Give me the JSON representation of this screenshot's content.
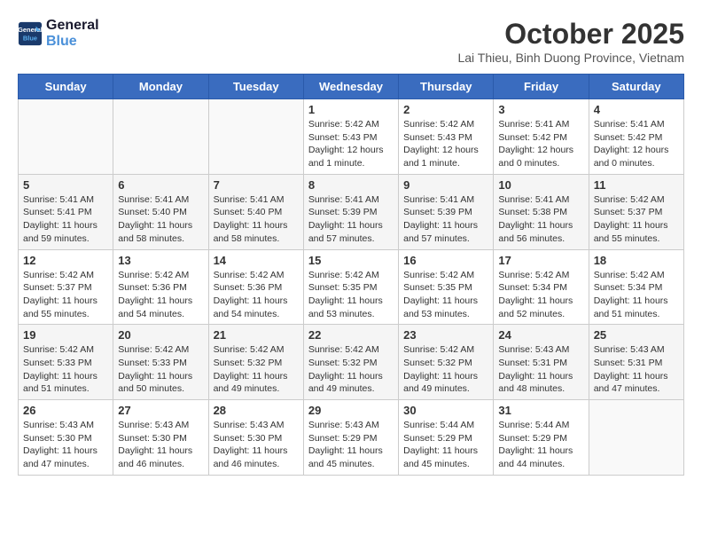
{
  "header": {
    "logo_line1": "General",
    "logo_line2": "Blue",
    "month": "October 2025",
    "location": "Lai Thieu, Binh Duong Province, Vietnam"
  },
  "days_of_week": [
    "Sunday",
    "Monday",
    "Tuesday",
    "Wednesday",
    "Thursday",
    "Friday",
    "Saturday"
  ],
  "weeks": [
    {
      "days": [
        {
          "num": "",
          "info": ""
        },
        {
          "num": "",
          "info": ""
        },
        {
          "num": "",
          "info": ""
        },
        {
          "num": "1",
          "info": "Sunrise: 5:42 AM\nSunset: 5:43 PM\nDaylight: 12 hours\nand 1 minute."
        },
        {
          "num": "2",
          "info": "Sunrise: 5:42 AM\nSunset: 5:43 PM\nDaylight: 12 hours\nand 1 minute."
        },
        {
          "num": "3",
          "info": "Sunrise: 5:41 AM\nSunset: 5:42 PM\nDaylight: 12 hours\nand 0 minutes."
        },
        {
          "num": "4",
          "info": "Sunrise: 5:41 AM\nSunset: 5:42 PM\nDaylight: 12 hours\nand 0 minutes."
        }
      ]
    },
    {
      "days": [
        {
          "num": "5",
          "info": "Sunrise: 5:41 AM\nSunset: 5:41 PM\nDaylight: 11 hours\nand 59 minutes."
        },
        {
          "num": "6",
          "info": "Sunrise: 5:41 AM\nSunset: 5:40 PM\nDaylight: 11 hours\nand 58 minutes."
        },
        {
          "num": "7",
          "info": "Sunrise: 5:41 AM\nSunset: 5:40 PM\nDaylight: 11 hours\nand 58 minutes."
        },
        {
          "num": "8",
          "info": "Sunrise: 5:41 AM\nSunset: 5:39 PM\nDaylight: 11 hours\nand 57 minutes."
        },
        {
          "num": "9",
          "info": "Sunrise: 5:41 AM\nSunset: 5:39 PM\nDaylight: 11 hours\nand 57 minutes."
        },
        {
          "num": "10",
          "info": "Sunrise: 5:41 AM\nSunset: 5:38 PM\nDaylight: 11 hours\nand 56 minutes."
        },
        {
          "num": "11",
          "info": "Sunrise: 5:42 AM\nSunset: 5:37 PM\nDaylight: 11 hours\nand 55 minutes."
        }
      ]
    },
    {
      "days": [
        {
          "num": "12",
          "info": "Sunrise: 5:42 AM\nSunset: 5:37 PM\nDaylight: 11 hours\nand 55 minutes."
        },
        {
          "num": "13",
          "info": "Sunrise: 5:42 AM\nSunset: 5:36 PM\nDaylight: 11 hours\nand 54 minutes."
        },
        {
          "num": "14",
          "info": "Sunrise: 5:42 AM\nSunset: 5:36 PM\nDaylight: 11 hours\nand 54 minutes."
        },
        {
          "num": "15",
          "info": "Sunrise: 5:42 AM\nSunset: 5:35 PM\nDaylight: 11 hours\nand 53 minutes."
        },
        {
          "num": "16",
          "info": "Sunrise: 5:42 AM\nSunset: 5:35 PM\nDaylight: 11 hours\nand 53 minutes."
        },
        {
          "num": "17",
          "info": "Sunrise: 5:42 AM\nSunset: 5:34 PM\nDaylight: 11 hours\nand 52 minutes."
        },
        {
          "num": "18",
          "info": "Sunrise: 5:42 AM\nSunset: 5:34 PM\nDaylight: 11 hours\nand 51 minutes."
        }
      ]
    },
    {
      "days": [
        {
          "num": "19",
          "info": "Sunrise: 5:42 AM\nSunset: 5:33 PM\nDaylight: 11 hours\nand 51 minutes."
        },
        {
          "num": "20",
          "info": "Sunrise: 5:42 AM\nSunset: 5:33 PM\nDaylight: 11 hours\nand 50 minutes."
        },
        {
          "num": "21",
          "info": "Sunrise: 5:42 AM\nSunset: 5:32 PM\nDaylight: 11 hours\nand 49 minutes."
        },
        {
          "num": "22",
          "info": "Sunrise: 5:42 AM\nSunset: 5:32 PM\nDaylight: 11 hours\nand 49 minutes."
        },
        {
          "num": "23",
          "info": "Sunrise: 5:42 AM\nSunset: 5:32 PM\nDaylight: 11 hours\nand 49 minutes."
        },
        {
          "num": "24",
          "info": "Sunrise: 5:43 AM\nSunset: 5:31 PM\nDaylight: 11 hours\nand 48 minutes."
        },
        {
          "num": "25",
          "info": "Sunrise: 5:43 AM\nSunset: 5:31 PM\nDaylight: 11 hours\nand 47 minutes."
        }
      ]
    },
    {
      "days": [
        {
          "num": "26",
          "info": "Sunrise: 5:43 AM\nSunset: 5:30 PM\nDaylight: 11 hours\nand 47 minutes."
        },
        {
          "num": "27",
          "info": "Sunrise: 5:43 AM\nSunset: 5:30 PM\nDaylight: 11 hours\nand 46 minutes."
        },
        {
          "num": "28",
          "info": "Sunrise: 5:43 AM\nSunset: 5:30 PM\nDaylight: 11 hours\nand 46 minutes."
        },
        {
          "num": "29",
          "info": "Sunrise: 5:43 AM\nSunset: 5:29 PM\nDaylight: 11 hours\nand 45 minutes."
        },
        {
          "num": "30",
          "info": "Sunrise: 5:44 AM\nSunset: 5:29 PM\nDaylight: 11 hours\nand 45 minutes."
        },
        {
          "num": "31",
          "info": "Sunrise: 5:44 AM\nSunset: 5:29 PM\nDaylight: 11 hours\nand 44 minutes."
        },
        {
          "num": "",
          "info": ""
        }
      ]
    }
  ]
}
